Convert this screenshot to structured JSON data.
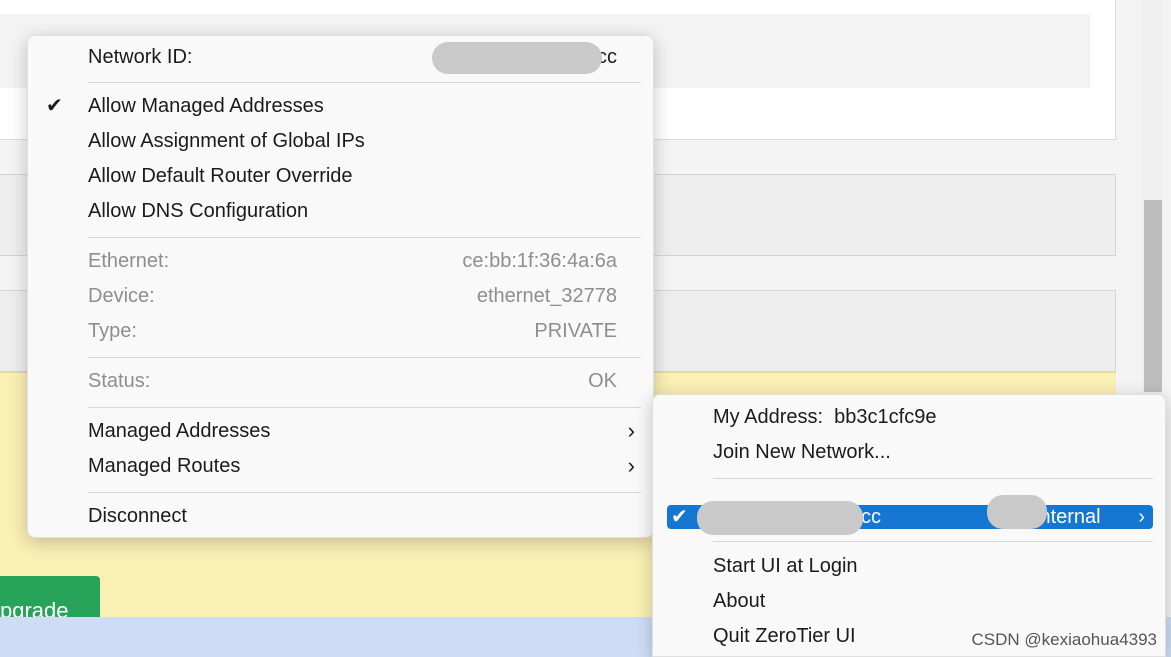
{
  "background": {
    "upgrade_button_label": "pgrade"
  },
  "network_menu": {
    "network_id_label": "Network ID:",
    "network_id_suffix": "cc",
    "options": [
      {
        "label": "Allow Managed Addresses",
        "checked": true
      },
      {
        "label": "Allow Assignment of Global IPs",
        "checked": false
      },
      {
        "label": "Allow Default Router Override",
        "checked": false
      },
      {
        "label": "Allow DNS Configuration",
        "checked": false
      }
    ],
    "info": {
      "ethernet_label": "Ethernet:",
      "ethernet_value": "ce:bb:1f:36:4a:6a",
      "device_label": "Device:",
      "device_value": "ethernet_32778",
      "type_label": "Type:",
      "type_value": "PRIVATE",
      "status_label": "Status:",
      "status_value": "OK"
    },
    "managed_addresses_label": "Managed Addresses",
    "managed_routes_label": "Managed Routes",
    "disconnect_label": "Disconnect"
  },
  "tray_menu": {
    "my_address_label": "My Address:",
    "my_address_value": "bb3c1cfc9e",
    "join_label": "Join New Network...",
    "network_row": {
      "id_suffix": "cc",
      "name_suffix": "internal",
      "checked": true
    },
    "start_at_login_label": "Start UI at Login",
    "about_label": "About",
    "quit_label": "Quit ZeroTier UI"
  },
  "watermark": "CSDN @kexiaohua4393",
  "colors": {
    "highlight": "#1677d2",
    "upgrade_button": "#27a35a",
    "yellow_banner": "#faf0b4",
    "bottom_bar": "#cdddf5"
  },
  "icons": {
    "check": "checkmark-icon",
    "submenu": "chevron-right-icon"
  }
}
